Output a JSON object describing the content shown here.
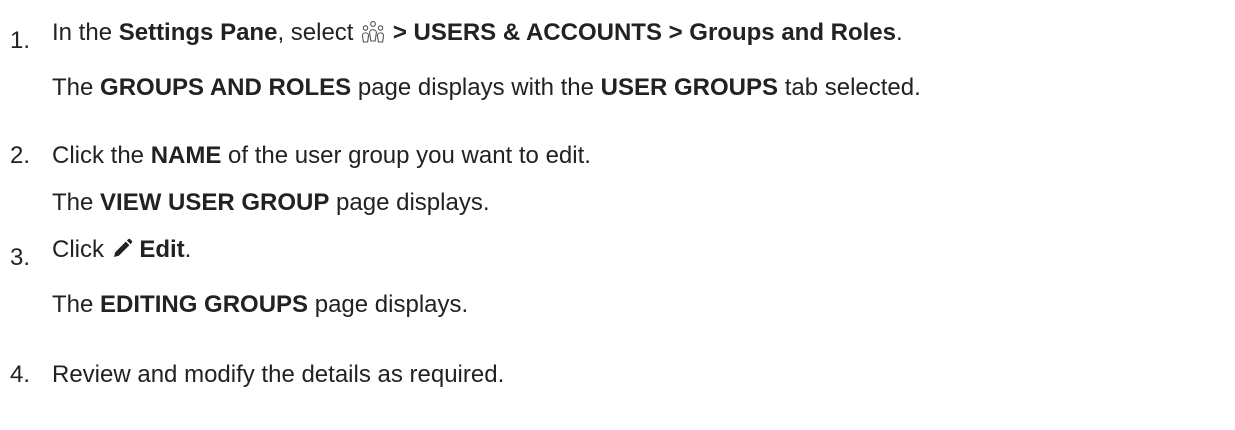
{
  "steps": [
    {
      "number": "1.",
      "instruction": {
        "prefix": "In the ",
        "settings_pane": "Settings Pane",
        "middle": ", select ",
        "path_part1": "> USERS & ACCOUNTS > Groups and Roles",
        "suffix": "."
      },
      "result": {
        "prefix": "The ",
        "page_name": "GROUPS AND ROLES",
        "middle": " page displays with the ",
        "tab_name": "USER GROUPS",
        "suffix": " tab selected."
      }
    },
    {
      "number": "2.",
      "instruction": {
        "prefix": "Click the ",
        "name": "NAME",
        "suffix": " of the user group you want to edit."
      },
      "result": {
        "prefix": "The ",
        "page_name": "VIEW USER GROUP",
        "suffix": " page displays."
      }
    },
    {
      "number": "3.",
      "instruction": {
        "prefix": "Click ",
        "edit_label": "Edit",
        "suffix": "."
      },
      "result": {
        "prefix": "The ",
        "page_name": "EDITING GROUPS",
        "suffix": " page displays."
      }
    },
    {
      "number": "4.",
      "instruction": {
        "text": "Review and modify the details as required."
      }
    }
  ],
  "icons": {
    "users_icon": "users-icon",
    "edit_icon": "pencil-icon"
  }
}
